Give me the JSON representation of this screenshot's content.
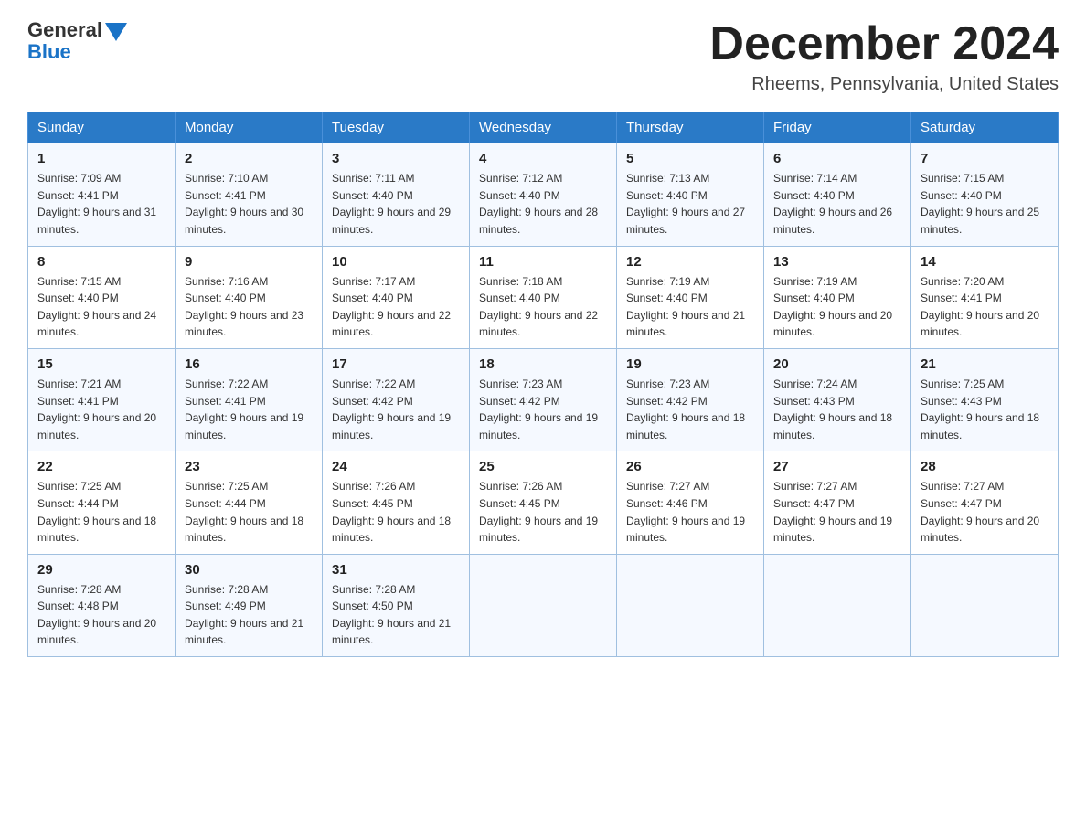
{
  "logo": {
    "general": "General",
    "blue": "Blue"
  },
  "title": "December 2024",
  "location": "Rheems, Pennsylvania, United States",
  "headers": [
    "Sunday",
    "Monday",
    "Tuesday",
    "Wednesday",
    "Thursday",
    "Friday",
    "Saturday"
  ],
  "weeks": [
    [
      {
        "day": "1",
        "sunrise": "7:09 AM",
        "sunset": "4:41 PM",
        "daylight": "9 hours and 31 minutes."
      },
      {
        "day": "2",
        "sunrise": "7:10 AM",
        "sunset": "4:41 PM",
        "daylight": "9 hours and 30 minutes."
      },
      {
        "day": "3",
        "sunrise": "7:11 AM",
        "sunset": "4:40 PM",
        "daylight": "9 hours and 29 minutes."
      },
      {
        "day": "4",
        "sunrise": "7:12 AM",
        "sunset": "4:40 PM",
        "daylight": "9 hours and 28 minutes."
      },
      {
        "day": "5",
        "sunrise": "7:13 AM",
        "sunset": "4:40 PM",
        "daylight": "9 hours and 27 minutes."
      },
      {
        "day": "6",
        "sunrise": "7:14 AM",
        "sunset": "4:40 PM",
        "daylight": "9 hours and 26 minutes."
      },
      {
        "day": "7",
        "sunrise": "7:15 AM",
        "sunset": "4:40 PM",
        "daylight": "9 hours and 25 minutes."
      }
    ],
    [
      {
        "day": "8",
        "sunrise": "7:15 AM",
        "sunset": "4:40 PM",
        "daylight": "9 hours and 24 minutes."
      },
      {
        "day": "9",
        "sunrise": "7:16 AM",
        "sunset": "4:40 PM",
        "daylight": "9 hours and 23 minutes."
      },
      {
        "day": "10",
        "sunrise": "7:17 AM",
        "sunset": "4:40 PM",
        "daylight": "9 hours and 22 minutes."
      },
      {
        "day": "11",
        "sunrise": "7:18 AM",
        "sunset": "4:40 PM",
        "daylight": "9 hours and 22 minutes."
      },
      {
        "day": "12",
        "sunrise": "7:19 AM",
        "sunset": "4:40 PM",
        "daylight": "9 hours and 21 minutes."
      },
      {
        "day": "13",
        "sunrise": "7:19 AM",
        "sunset": "4:40 PM",
        "daylight": "9 hours and 20 minutes."
      },
      {
        "day": "14",
        "sunrise": "7:20 AM",
        "sunset": "4:41 PM",
        "daylight": "9 hours and 20 minutes."
      }
    ],
    [
      {
        "day": "15",
        "sunrise": "7:21 AM",
        "sunset": "4:41 PM",
        "daylight": "9 hours and 20 minutes."
      },
      {
        "day": "16",
        "sunrise": "7:22 AM",
        "sunset": "4:41 PM",
        "daylight": "9 hours and 19 minutes."
      },
      {
        "day": "17",
        "sunrise": "7:22 AM",
        "sunset": "4:42 PM",
        "daylight": "9 hours and 19 minutes."
      },
      {
        "day": "18",
        "sunrise": "7:23 AM",
        "sunset": "4:42 PM",
        "daylight": "9 hours and 19 minutes."
      },
      {
        "day": "19",
        "sunrise": "7:23 AM",
        "sunset": "4:42 PM",
        "daylight": "9 hours and 18 minutes."
      },
      {
        "day": "20",
        "sunrise": "7:24 AM",
        "sunset": "4:43 PM",
        "daylight": "9 hours and 18 minutes."
      },
      {
        "day": "21",
        "sunrise": "7:25 AM",
        "sunset": "4:43 PM",
        "daylight": "9 hours and 18 minutes."
      }
    ],
    [
      {
        "day": "22",
        "sunrise": "7:25 AM",
        "sunset": "4:44 PM",
        "daylight": "9 hours and 18 minutes."
      },
      {
        "day": "23",
        "sunrise": "7:25 AM",
        "sunset": "4:44 PM",
        "daylight": "9 hours and 18 minutes."
      },
      {
        "day": "24",
        "sunrise": "7:26 AM",
        "sunset": "4:45 PM",
        "daylight": "9 hours and 18 minutes."
      },
      {
        "day": "25",
        "sunrise": "7:26 AM",
        "sunset": "4:45 PM",
        "daylight": "9 hours and 19 minutes."
      },
      {
        "day": "26",
        "sunrise": "7:27 AM",
        "sunset": "4:46 PM",
        "daylight": "9 hours and 19 minutes."
      },
      {
        "day": "27",
        "sunrise": "7:27 AM",
        "sunset": "4:47 PM",
        "daylight": "9 hours and 19 minutes."
      },
      {
        "day": "28",
        "sunrise": "7:27 AM",
        "sunset": "4:47 PM",
        "daylight": "9 hours and 20 minutes."
      }
    ],
    [
      {
        "day": "29",
        "sunrise": "7:28 AM",
        "sunset": "4:48 PM",
        "daylight": "9 hours and 20 minutes."
      },
      {
        "day": "30",
        "sunrise": "7:28 AM",
        "sunset": "4:49 PM",
        "daylight": "9 hours and 21 minutes."
      },
      {
        "day": "31",
        "sunrise": "7:28 AM",
        "sunset": "4:50 PM",
        "daylight": "9 hours and 21 minutes."
      },
      null,
      null,
      null,
      null
    ]
  ]
}
